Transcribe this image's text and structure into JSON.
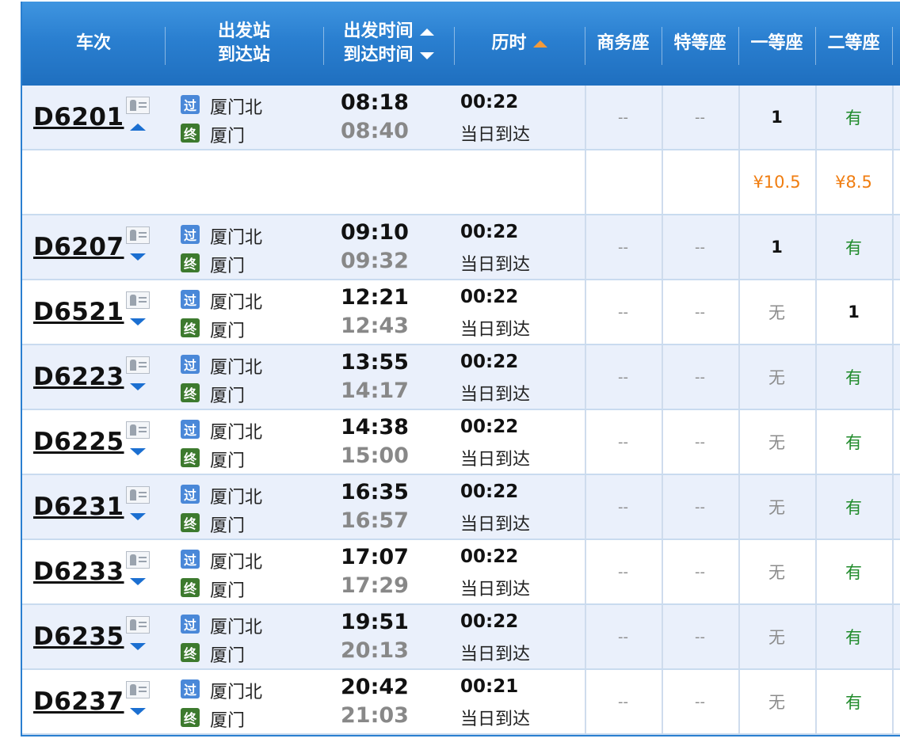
{
  "header": {
    "train_no": "车次",
    "from_station": "出发站",
    "to_station": "到达站",
    "depart_time": "出发时间",
    "arrive_time": "到达时间",
    "duration": "历时",
    "business_seat": "商务座",
    "premium_seat": "特等座",
    "first_class": "一等座",
    "second_class": "二等座"
  },
  "badges": {
    "pass": "过",
    "end": "终"
  },
  "trains": [
    {
      "no": "D6201",
      "from": "厦门北",
      "to": "厦门",
      "dep": "08:18",
      "arr": "08:40",
      "dur": "00:22",
      "day": "当日到达",
      "biz": "--",
      "premium": "--",
      "first": "1",
      "second": "有",
      "expanded": true
    },
    {
      "no": "D6207",
      "from": "厦门北",
      "to": "厦门",
      "dep": "09:10",
      "arr": "09:32",
      "dur": "00:22",
      "day": "当日到达",
      "biz": "--",
      "premium": "--",
      "first": "1",
      "second": "有"
    },
    {
      "no": "D6521",
      "from": "厦门北",
      "to": "厦门",
      "dep": "12:21",
      "arr": "12:43",
      "dur": "00:22",
      "day": "当日到达",
      "biz": "--",
      "premium": "--",
      "first": "无",
      "second": "1"
    },
    {
      "no": "D6223",
      "from": "厦门北",
      "to": "厦门",
      "dep": "13:55",
      "arr": "14:17",
      "dur": "00:22",
      "day": "当日到达",
      "biz": "--",
      "premium": "--",
      "first": "无",
      "second": "有"
    },
    {
      "no": "D6225",
      "from": "厦门北",
      "to": "厦门",
      "dep": "14:38",
      "arr": "15:00",
      "dur": "00:22",
      "day": "当日到达",
      "biz": "--",
      "premium": "--",
      "first": "无",
      "second": "有"
    },
    {
      "no": "D6231",
      "from": "厦门北",
      "to": "厦门",
      "dep": "16:35",
      "arr": "16:57",
      "dur": "00:22",
      "day": "当日到达",
      "biz": "--",
      "premium": "--",
      "first": "无",
      "second": "有"
    },
    {
      "no": "D6233",
      "from": "厦门北",
      "to": "厦门",
      "dep": "17:07",
      "arr": "17:29",
      "dur": "00:22",
      "day": "当日到达",
      "biz": "--",
      "premium": "--",
      "first": "无",
      "second": "有"
    },
    {
      "no": "D6235",
      "from": "厦门北",
      "to": "厦门",
      "dep": "19:51",
      "arr": "20:13",
      "dur": "00:22",
      "day": "当日到达",
      "biz": "--",
      "premium": "--",
      "first": "无",
      "second": "有"
    },
    {
      "no": "D6237",
      "from": "厦门北",
      "to": "厦门",
      "dep": "20:42",
      "arr": "21:03",
      "dur": "00:21",
      "day": "当日到达",
      "biz": "--",
      "premium": "--",
      "first": "无",
      "second": "有"
    }
  ],
  "price_row": {
    "first_price": "¥10.5",
    "second_price": "¥8.5"
  },
  "colors": {
    "header_blue": "#2a7fd0",
    "available_green": "#1f8a2a",
    "price_orange": "#f07d10",
    "sort_orange": "#f39a3a"
  },
  "icons": {
    "sort_asc": "triangle-up-icon",
    "sort_desc": "triangle-down-icon",
    "passenger_card": "id-card-icon",
    "expand": "chevron-down-icon",
    "collapse": "chevron-up-icon"
  }
}
